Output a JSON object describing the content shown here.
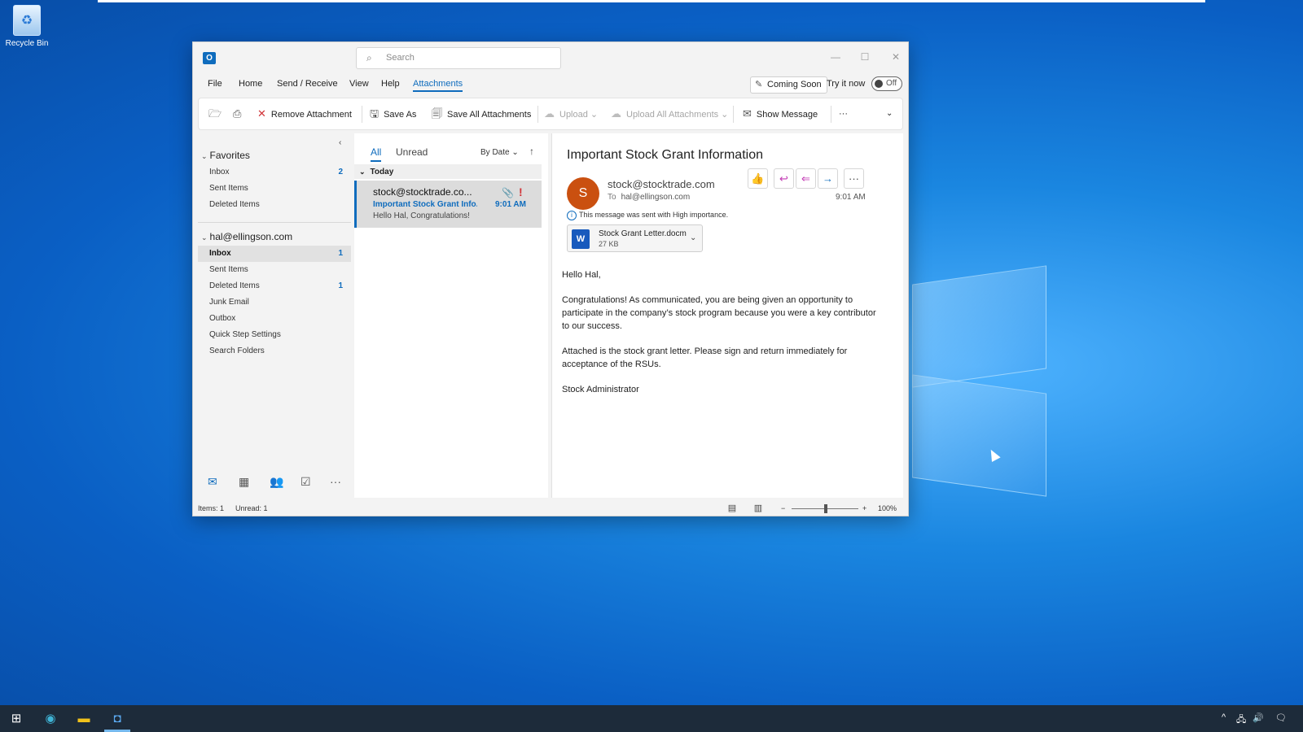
{
  "desktop": {
    "recycle_bin_label": "Recycle Bin"
  },
  "window": {
    "search_placeholder": "Search",
    "controls": {
      "minimize": "—",
      "maximize": "☐",
      "close": "✕"
    }
  },
  "menu": {
    "items": [
      "File",
      "Home",
      "Send / Receive",
      "View",
      "Help",
      "Attachments"
    ],
    "active": "Attachments",
    "coming_soon": "Coming Soon",
    "try_it_now": "Try it now",
    "toggle_state": "Off"
  },
  "ribbon": {
    "remove_attachment": "Remove Attachment",
    "save_as": "Save As",
    "save_all_attachments": "Save All Attachments",
    "upload": "Upload",
    "upload_all_attachments": "Upload All Attachments",
    "show_message": "Show Message",
    "more": "···"
  },
  "folders": {
    "favorites_header": "Favorites",
    "favorites": [
      {
        "label": "Inbox",
        "count": "2"
      },
      {
        "label": "Sent Items",
        "count": ""
      },
      {
        "label": "Deleted Items",
        "count": ""
      }
    ],
    "account_header": "hal@ellingson.com",
    "account_items": [
      {
        "label": "Inbox",
        "count": "1"
      },
      {
        "label": "Sent Items",
        "count": ""
      },
      {
        "label": "Deleted Items",
        "count": "1"
      },
      {
        "label": "Junk Email",
        "count": ""
      },
      {
        "label": "Outbox",
        "count": ""
      },
      {
        "label": "Quick Step Settings",
        "count": ""
      },
      {
        "label": "Search Folders",
        "count": ""
      }
    ]
  },
  "list": {
    "tab_all": "All",
    "tab_unread": "Unread",
    "sort_label": "By Date",
    "group_today": "Today",
    "message": {
      "from": "stock@stocktrade.co...",
      "subject": "Important Stock Grant Info...",
      "preview": "Hello Hal,  Congratulations!",
      "time": "9:01 AM"
    }
  },
  "reading": {
    "subject": "Important Stock Grant Information",
    "avatar_letter": "S",
    "sender": "stock@stocktrade.com",
    "to_label": "To",
    "to_address": "hal@ellingson.com",
    "time": "9:01 AM",
    "importance_note": "This message was sent with High importance.",
    "attachment_name": "Stock Grant Letter.docm",
    "attachment_size": "27 KB",
    "body": {
      "greeting": "Hello Hal,",
      "para1": "Congratulations! As communicated, you are being given an opportunity to participate in the company’s stock program because you were a key contributor to our success.",
      "para2": "Attached is the stock grant letter. Please sign and return immediately for acceptance of the RSUs.",
      "signature": "Stock Administrator"
    }
  },
  "status": {
    "items": "Items: 1",
    "unread": "Unread: 1",
    "zoom_level": "100%"
  },
  "colors": {
    "accent": "#0f6cbd",
    "importance": "#d13438",
    "avatar": "#ca5010"
  }
}
